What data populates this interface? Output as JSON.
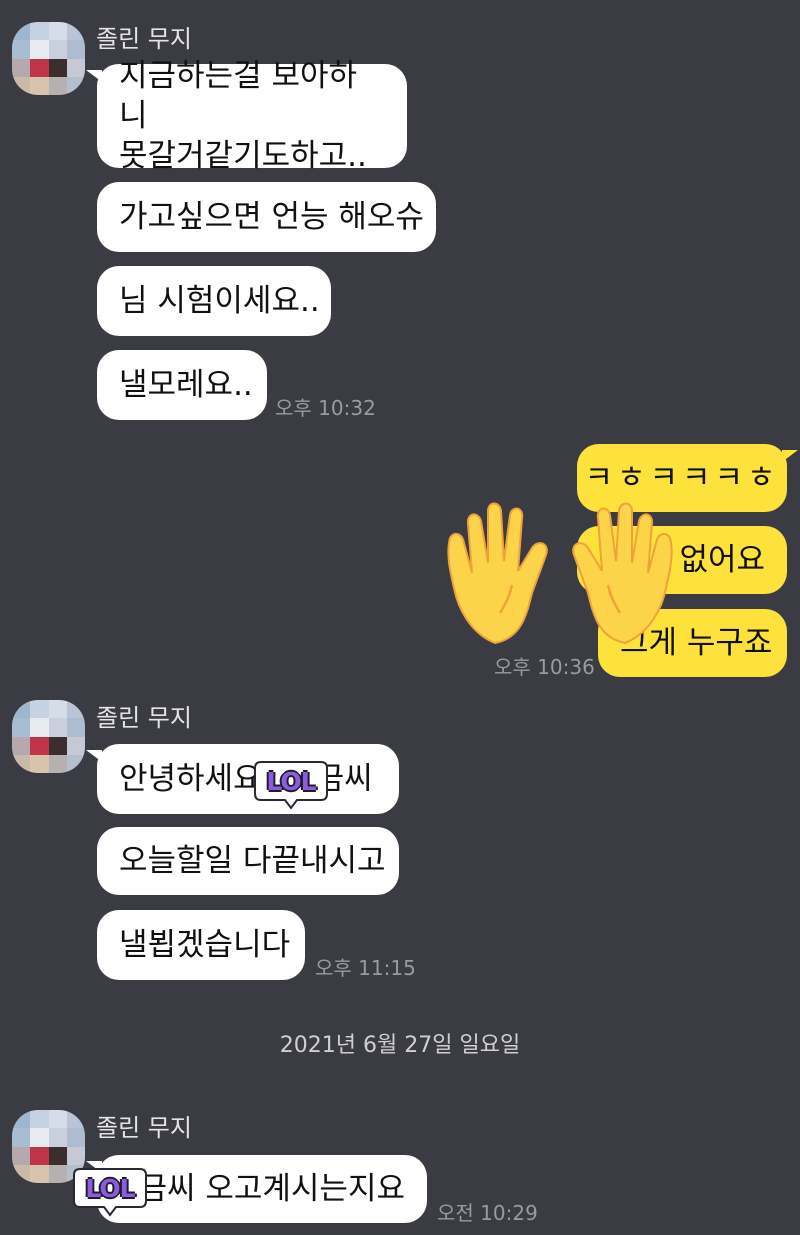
{
  "sender_name": "졸린 무지",
  "groups": [
    {
      "messages": [
        "지금하는걸 보아하니\n못갈거같기도하고..",
        "가고싶으면 언능 해오슈",
        "님 시험이세요..",
        "낼모레요.."
      ],
      "time": "오후 10:32"
    },
    {
      "messages": [
        "안녕하세요",
        "금씨",
        "오늘할일 다끝내시고",
        "낼뵙겠습니다"
      ],
      "time": "오후 11:15"
    },
    {
      "messages": [
        "금씨 오고계시는지요"
      ],
      "time": "오전 10:29"
    }
  ],
  "my_messages": {
    "messages": [
      "ㅋㅎㅋㅋㅋㅎ",
      "없어요",
      "그게 누구죠"
    ],
    "time": "오후 10:36"
  },
  "date_divider": "2021년 6월 27일 일요일",
  "stickers": {
    "lol_label": "LOL",
    "hands_emoji": "raised-hands"
  },
  "colors": {
    "background": "#3b3b43",
    "my_bubble": "#fde23b",
    "their_bubble": "#ffffff"
  }
}
